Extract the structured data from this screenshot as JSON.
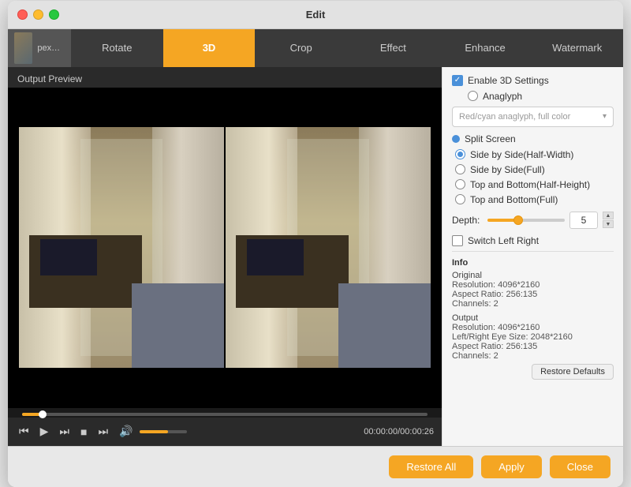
{
  "window": {
    "title": "Edit"
  },
  "toolbar": {
    "tabs": [
      {
        "id": "rotate",
        "label": "Rotate",
        "active": false
      },
      {
        "id": "3d",
        "label": "3D",
        "active": true
      },
      {
        "id": "crop",
        "label": "Crop",
        "active": false
      },
      {
        "id": "effect",
        "label": "Effect",
        "active": false
      },
      {
        "id": "enhance",
        "label": "Enhance",
        "active": false
      },
      {
        "id": "watermark",
        "label": "Watermark",
        "active": false
      }
    ],
    "file_label": "pexels-cot..."
  },
  "preview": {
    "output_label": "Output Preview",
    "time_display": "00:00:00/00:00:26"
  },
  "settings": {
    "enable_3d_label": "Enable 3D Settings",
    "anaglyph_label": "Anaglyph",
    "anaglyph_option": "Red/cyan anaglyph, full color",
    "split_screen_label": "Split Screen",
    "options": [
      {
        "id": "side-by-side-half",
        "label": "Side by Side(Half-Width)",
        "selected": true
      },
      {
        "id": "side-by-side-full",
        "label": "Side by Side(Full)",
        "selected": false
      },
      {
        "id": "top-bottom-half",
        "label": "Top and Bottom(Half-Height)",
        "selected": false
      },
      {
        "id": "top-bottom-full",
        "label": "Top and Bottom(Full)",
        "selected": false
      }
    ],
    "depth_label": "Depth:",
    "depth_value": "5",
    "switch_left_right_label": "Switch Left Right",
    "info_title": "Info",
    "original_label": "Original",
    "original_resolution": "Resolution: 4096*2160",
    "original_aspect": "Aspect Ratio: 256:135",
    "original_channels": "Channels: 2",
    "output_label": "Output",
    "output_resolution": "Resolution: 4096*2160",
    "output_eye_size": "Left/Right Eye Size: 2048*2160",
    "output_aspect": "Aspect Ratio: 256:135",
    "output_channels": "Channels: 2"
  },
  "buttons": {
    "restore_defaults": "Restore Defaults",
    "restore_all": "Restore All",
    "apply": "Apply",
    "close": "Close"
  }
}
